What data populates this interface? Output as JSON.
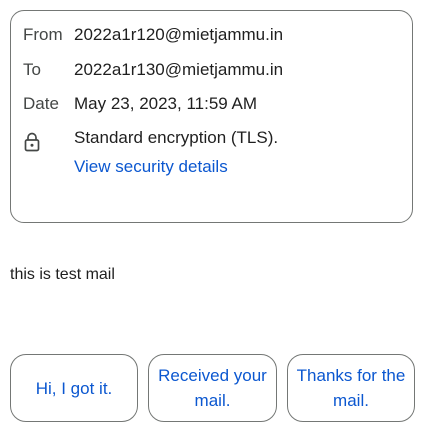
{
  "details": {
    "from_label": "From",
    "from_value": "2022a1r120@mietjammu.in",
    "to_label": "To",
    "to_value": "2022a1r130@mietjammu.in",
    "date_label": "Date",
    "date_value": "May 23, 2023, 11:59 AM",
    "security_icon": "lock-icon",
    "security_text": "Standard encryption (TLS).",
    "security_link": "View security details"
  },
  "message": {
    "body": "this is test mail"
  },
  "smart_replies": [
    {
      "label": "Hi, I got it."
    },
    {
      "label": "Received your mail."
    },
    {
      "label": "Thanks for the mail."
    }
  ],
  "colors": {
    "link": "#0b57d0",
    "border": "#747775",
    "label": "#444746",
    "text": "#1f1f1f"
  }
}
